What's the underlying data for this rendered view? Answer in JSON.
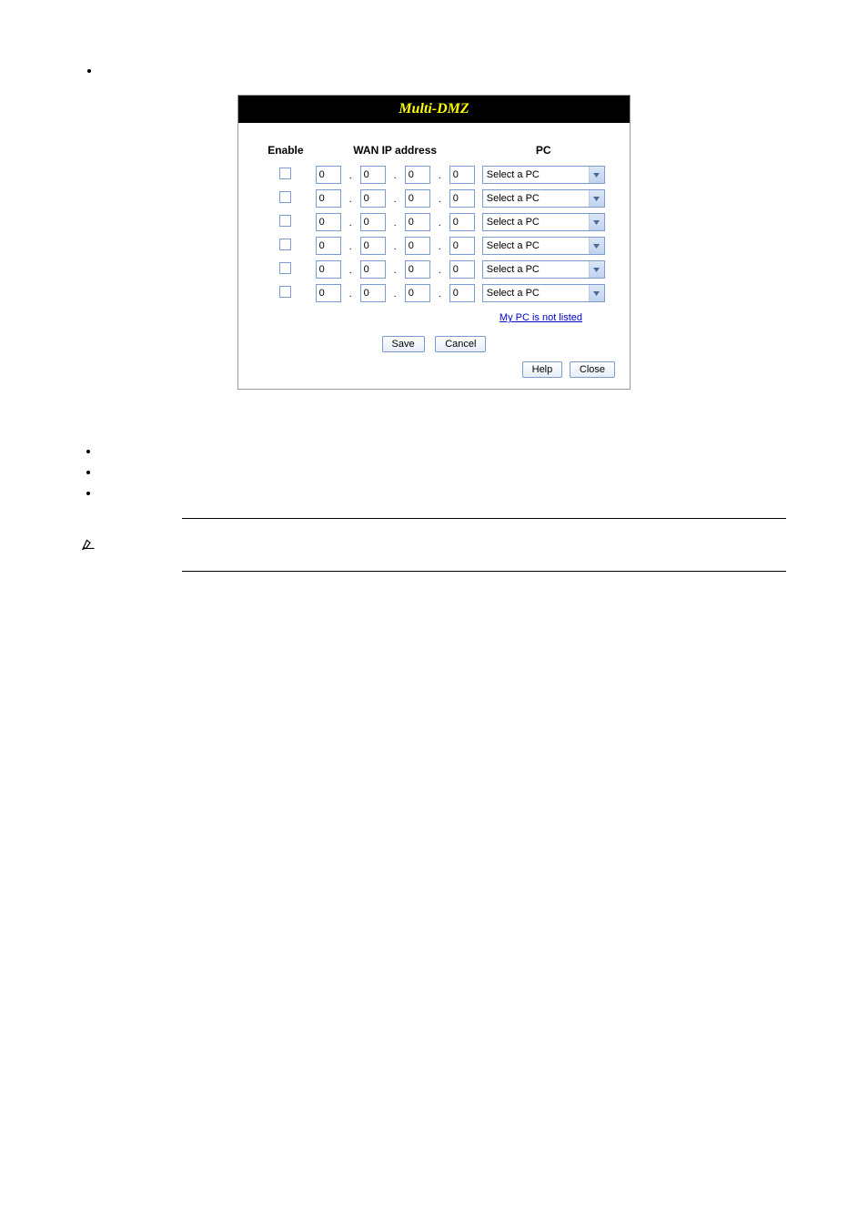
{
  "dialog": {
    "title": "Multi-DMZ",
    "headers": {
      "enable": "Enable",
      "wan_ip": "WAN IP address",
      "pc": "PC"
    },
    "rows": [
      {
        "oct": [
          "0",
          "0",
          "0",
          "0"
        ],
        "pc": "Select a PC"
      },
      {
        "oct": [
          "0",
          "0",
          "0",
          "0"
        ],
        "pc": "Select a PC"
      },
      {
        "oct": [
          "0",
          "0",
          "0",
          "0"
        ],
        "pc": "Select a PC"
      },
      {
        "oct": [
          "0",
          "0",
          "0",
          "0"
        ],
        "pc": "Select a PC"
      },
      {
        "oct": [
          "0",
          "0",
          "0",
          "0"
        ],
        "pc": "Select a PC"
      },
      {
        "oct": [
          "0",
          "0",
          "0",
          "0"
        ],
        "pc": "Select a PC"
      }
    ],
    "not_listed": "My PC is not listed",
    "buttons": {
      "save": "Save",
      "cancel": "Cancel",
      "help": "Help",
      "close": "Close"
    }
  }
}
